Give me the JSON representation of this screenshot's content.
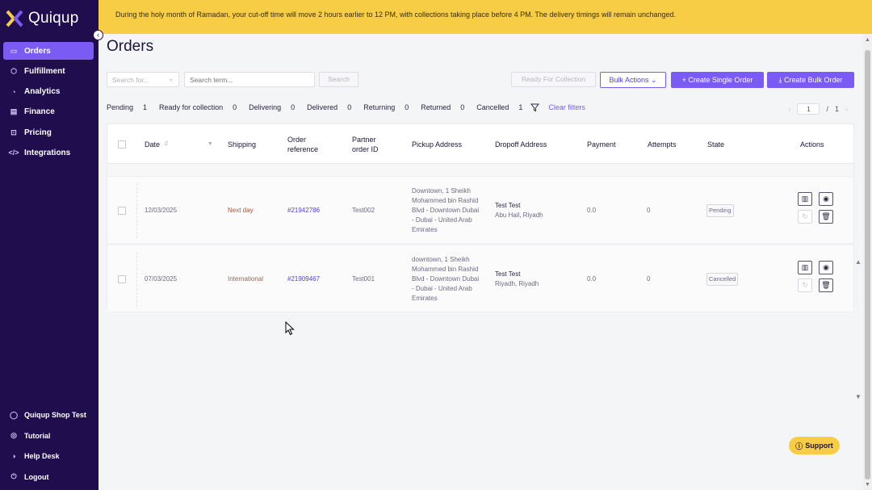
{
  "app": {
    "name": "Quiqup"
  },
  "banner": {
    "text": "During the holy month of Ramadan, your cut-off time will move 2 hours earlier to 12 PM, with collections taking place before 4 PM. The delivery timings will remain unchanged."
  },
  "sidebar": {
    "items": [
      {
        "label": "Orders",
        "icon": "box-icon",
        "active": true
      },
      {
        "label": "Fulfillment",
        "icon": "cube-icon"
      },
      {
        "label": "Analytics",
        "icon": "chart-icon"
      },
      {
        "label": "Finance",
        "icon": "wallet-icon"
      },
      {
        "label": "Pricing",
        "icon": "cart-icon"
      },
      {
        "label": "Integrations",
        "icon": "code-icon"
      }
    ],
    "bottom": [
      {
        "label": "Quiqup Shop Test",
        "icon": "user-icon"
      },
      {
        "label": "Tutorial",
        "icon": "play-icon"
      },
      {
        "label": "Help Desk",
        "icon": "headset-icon"
      },
      {
        "label": "Logout",
        "icon": "logout-icon"
      }
    ]
  },
  "page": {
    "title": "Orders"
  },
  "toolbar": {
    "search_for_placeholder": "Search for...",
    "search_term_placeholder": "Search term...",
    "search_label": "Search",
    "ready_label": "Ready For Collection",
    "bulk_actions_label": "Bulk Actions",
    "create_single_label": "Create Single Order",
    "create_bulk_label": "Create Bulk Order"
  },
  "filters": [
    {
      "label": "Pending",
      "count": "1"
    },
    {
      "label": "Ready for collection",
      "count": "0"
    },
    {
      "label": "Delivering",
      "count": "0"
    },
    {
      "label": "Delivered",
      "count": "0"
    },
    {
      "label": "Returning",
      "count": "0"
    },
    {
      "label": "Returned",
      "count": "0"
    },
    {
      "label": "Cancelled",
      "count": "1"
    }
  ],
  "clear_filters_label": "Clear filters",
  "pager": {
    "current": "1",
    "separator": "/",
    "total": "1"
  },
  "table": {
    "headers": {
      "date": "Date",
      "shipping": "Shipping",
      "order_ref_1": "Order",
      "order_ref_2": "reference",
      "partner_1": "Partner",
      "partner_2": "order ID",
      "pickup": "Pickup Address",
      "dropoff": "Dropoff Address",
      "payment": "Payment",
      "attempts": "Attempts",
      "state": "State",
      "actions": "Actions"
    },
    "rows": [
      {
        "date": "12/03/2025",
        "shipping": "Next day",
        "ref": "#21942786",
        "partner_id": "Test002",
        "pickup": "Downtown, 1 Sheikh Mohammed bin Rashid Blvd - Downtown Dubai - Dubai - United Arab Emirates",
        "drop_name": "Test Test",
        "drop_addr": "Abu Hail, Riyadh",
        "payment": "0.0",
        "attempts": "0",
        "state": "Pending"
      },
      {
        "date": "07/03/2025",
        "shipping": "International",
        "ref": "#21909467",
        "partner_id": "Test001",
        "pickup": "downtown, 1 Sheikh Mohammed bin Rashid Blvd - Downtown Dubai - Dubai - United Arab Emirates",
        "drop_name": "Test Test",
        "drop_addr": "Riyadh, Riyadh",
        "payment": "0.0",
        "attempts": "0",
        "state": "Cancelled"
      }
    ]
  },
  "support": {
    "label": "Support"
  },
  "colors": {
    "sidebar": "#1f0d4e",
    "accent": "#7a5cf5",
    "banner": "#f7cd45"
  }
}
